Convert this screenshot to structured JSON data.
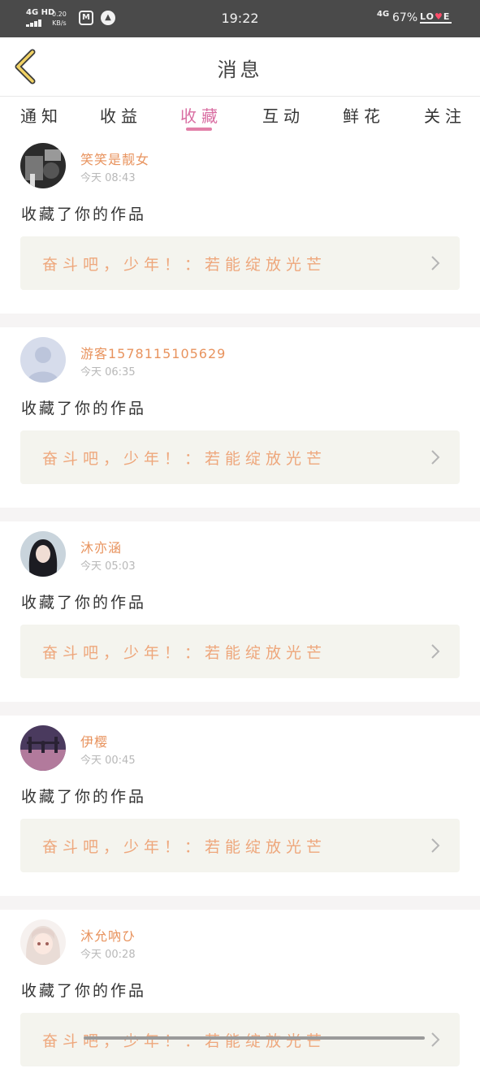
{
  "status_bar": {
    "network_left": "4G HD",
    "speed": "0.20",
    "speed_unit": "KB/s",
    "time": "19:22",
    "network_right": "4G",
    "battery": "67%",
    "love_l": "LO",
    "love_heart": "♥",
    "love_e": "E"
  },
  "header": {
    "title": "消息"
  },
  "tabs": [
    {
      "label": "通知"
    },
    {
      "label": "收益"
    },
    {
      "label": "收藏"
    },
    {
      "label": "互动"
    },
    {
      "label": "鲜花"
    },
    {
      "label": "关注"
    }
  ],
  "active_tab": 2,
  "feed": [
    {
      "user": "笑笑是靓女",
      "time": "今天 08:43",
      "action": "收藏了你的作品",
      "work": "奋斗吧，少年！：若能绽放光芒"
    },
    {
      "user": "游客1578115105629",
      "time": "今天 06:35",
      "action": "收藏了你的作品",
      "work": "奋斗吧，少年！：若能绽放光芒"
    },
    {
      "user": "沐亦涵",
      "time": "今天 05:03",
      "action": "收藏了你的作品",
      "work": "奋斗吧，少年！：若能绽放光芒"
    },
    {
      "user": "伊樱",
      "time": "今天 00:45",
      "action": "收藏了你的作品",
      "work": "奋斗吧，少年！：若能绽放光芒"
    },
    {
      "user": "沐允吶ひ",
      "time": "今天 00:28",
      "action": "收藏了你的作品",
      "work": "奋斗吧，少年！：若能绽放光芒"
    }
  ],
  "colors": {
    "accent": "#e27fa8",
    "username": "#e8935e",
    "work_title": "#eea77c"
  }
}
